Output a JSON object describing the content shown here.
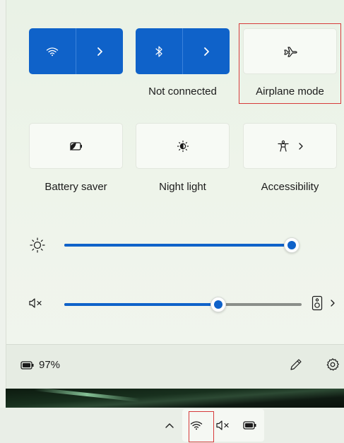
{
  "quick_settings": {
    "tiles_row1": [
      {
        "id": "wifi",
        "icon": "wifi-icon",
        "expand_icon": "chevron-right-icon",
        "label": "",
        "active": true
      },
      {
        "id": "bluetooth",
        "icon": "bluetooth-icon",
        "expand_icon": "chevron-right-icon",
        "label": "Not connected",
        "active": true
      },
      {
        "id": "airplane",
        "icon": "airplane-icon",
        "label": "Airplane mode",
        "active": false,
        "highlighted": true
      }
    ],
    "tiles_row2": [
      {
        "id": "battery_saver",
        "icon": "battery-saver-icon",
        "label": "Battery saver",
        "active": false
      },
      {
        "id": "night_light",
        "icon": "night-light-icon",
        "label": "Night light",
        "active": false
      },
      {
        "id": "accessibility",
        "icon": "accessibility-icon",
        "expand_icon": "chevron-right-icon",
        "label": "Accessibility",
        "active": false
      }
    ],
    "brightness": {
      "icon": "brightness-icon",
      "value_fraction": 1.0
    },
    "volume": {
      "icon": "speaker-muted-icon",
      "value_fraction": 0.65,
      "device_icon": "speaker-device-icon",
      "expand_icon": "chevron-right-icon"
    },
    "footer": {
      "battery_icon": "battery-icon",
      "battery_text": "97%",
      "edit_icon": "pencil-icon",
      "settings_icon": "gear-icon"
    }
  },
  "taskbar": {
    "tray": [
      {
        "id": "overflow",
        "icon": "chevron-up-icon"
      },
      {
        "id": "wifi",
        "icon": "wifi-icon",
        "highlighted": true
      },
      {
        "id": "volume",
        "icon": "speaker-muted-icon"
      },
      {
        "id": "battery",
        "icon": "battery-icon"
      }
    ]
  },
  "colors": {
    "accent": "#0f62c9",
    "highlight": "#d63a3a",
    "panel_bg": "#eef4ea"
  }
}
